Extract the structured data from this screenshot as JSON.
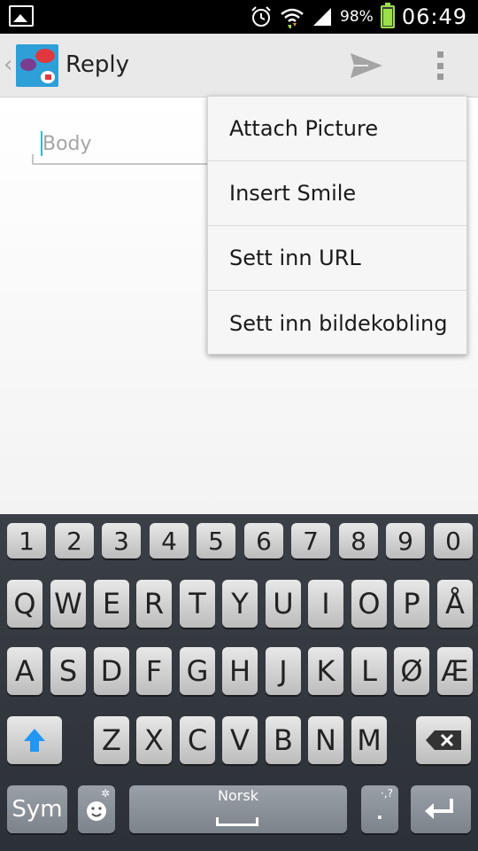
{
  "status_bar": {
    "battery_text": "98%",
    "time": "06:49",
    "battery_percent": 98
  },
  "action_bar": {
    "title": "Reply"
  },
  "compose": {
    "body_placeholder": "Body",
    "body_value": ""
  },
  "menu": {
    "items": [
      {
        "label": "Attach Picture"
      },
      {
        "label": "Insert Smile"
      },
      {
        "label": "Sett inn URL"
      },
      {
        "label": "Sett inn bildekobling"
      }
    ]
  },
  "keyboard": {
    "number_row": [
      "1",
      "2",
      "3",
      "4",
      "5",
      "6",
      "7",
      "8",
      "9",
      "0"
    ],
    "row1": [
      "Q",
      "W",
      "E",
      "R",
      "T",
      "Y",
      "U",
      "I",
      "O",
      "P",
      "Å"
    ],
    "row2": [
      "A",
      "S",
      "D",
      "F",
      "G",
      "H",
      "J",
      "K",
      "L",
      "Ø",
      "Æ"
    ],
    "row3": [
      "Z",
      "X",
      "C",
      "V",
      "B",
      "N",
      "M"
    ],
    "sym_label": "Sym",
    "space_label": "Norsk",
    "period_label": ".",
    "period_sub": "·,?",
    "emoji_sub": "✲"
  },
  "colors": {
    "accent": "#33b5e5",
    "shift": "#2196f3",
    "battery": "#9be04a"
  }
}
